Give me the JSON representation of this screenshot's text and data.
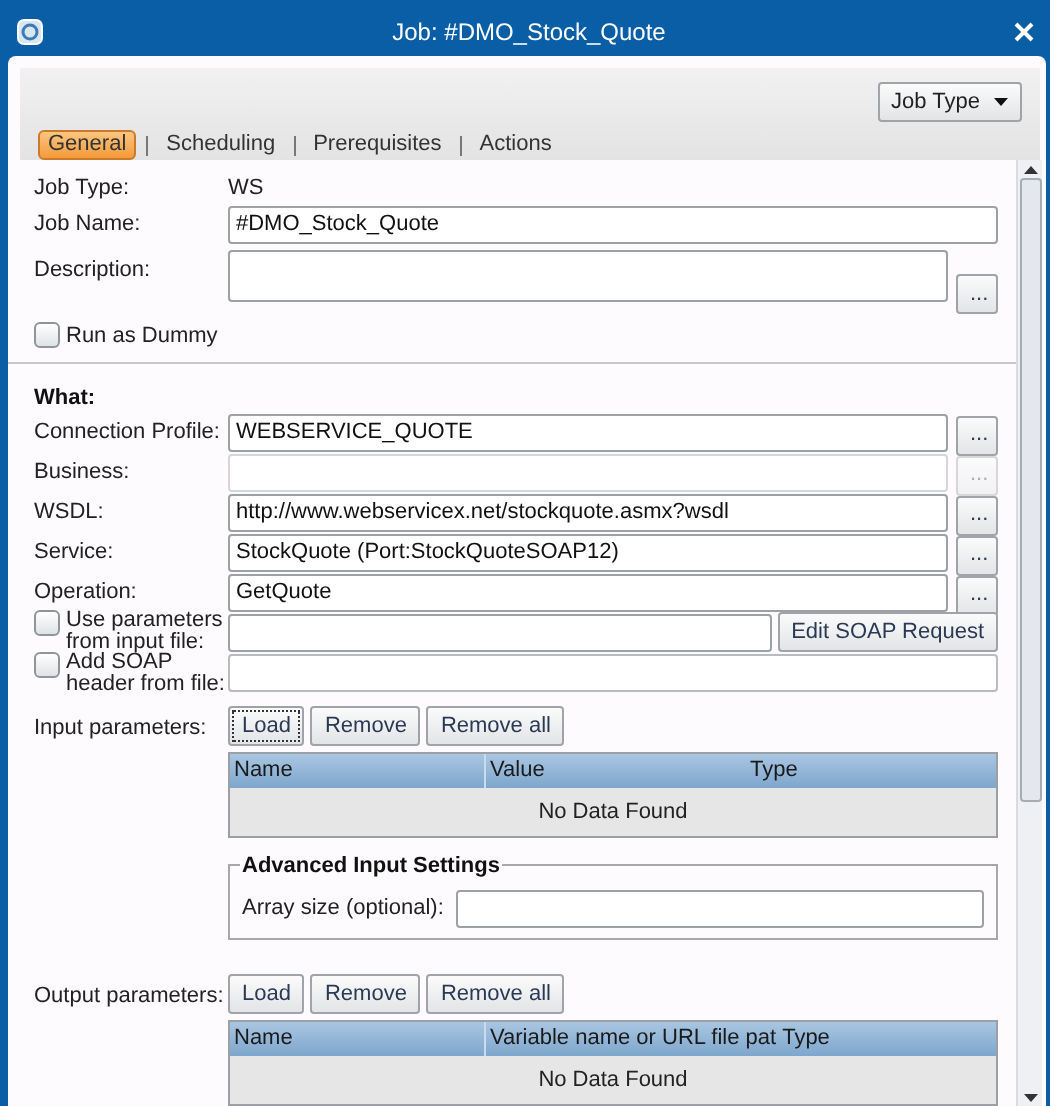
{
  "window": {
    "title": "Job: #DMO_Stock_Quote"
  },
  "job_type_button": {
    "label": "Job Type"
  },
  "tabs": [
    {
      "label": "General",
      "selected": true
    },
    {
      "label": "Scheduling",
      "selected": false
    },
    {
      "label": "Prerequisites",
      "selected": false
    },
    {
      "label": "Actions",
      "selected": false
    }
  ],
  "general": {
    "job_type": {
      "label": "Job Type:",
      "value": "WS"
    },
    "job_name": {
      "label": "Job Name:",
      "value": "#DMO_Stock_Quote"
    },
    "description": {
      "label": "Description:",
      "browse": "..."
    },
    "run_as_dummy": {
      "label": "Run as Dummy",
      "checked": false
    }
  },
  "what": {
    "heading": "What:",
    "fields": [
      {
        "label": "Connection Profile:",
        "value": "WEBSERVICE_QUOTE",
        "disabled": false,
        "browse": "..."
      },
      {
        "label": "Business:",
        "disabled": true,
        "browse": "..."
      },
      {
        "label": "WSDL:",
        "value": "http://www.webservicex.net/stockquote.asmx?wsdl",
        "disabled": false,
        "browse": "..."
      },
      {
        "label": "Service:",
        "value": "StockQuote (Port:StockQuoteSOAP12)",
        "disabled": false,
        "browse": "..."
      },
      {
        "label": "Operation:",
        "value": "GetQuote",
        "disabled": false,
        "browse": "..."
      }
    ],
    "use_params": {
      "label": "Use parameters from input file:",
      "checked": false,
      "button": "Edit SOAP Request"
    },
    "add_soap_header": {
      "label": "Add SOAP header from file:",
      "checked": false
    }
  },
  "input_parameters": {
    "label": "Input parameters:",
    "buttons": [
      {
        "label": "Load",
        "focused": true
      },
      {
        "label": "Remove",
        "focused": false
      },
      {
        "label": "Remove all",
        "focused": false
      }
    ],
    "table": {
      "columns": [
        "Name",
        "Value",
        "Type"
      ],
      "empty_text": "No Data Found"
    }
  },
  "advanced": {
    "title": "Advanced Input Settings",
    "array_size_label": "Array size (optional):"
  },
  "output_parameters": {
    "label": "Output parameters:",
    "buttons": [
      {
        "label": "Load",
        "focused": false
      },
      {
        "label": "Remove",
        "focused": false
      },
      {
        "label": "Remove all",
        "focused": false
      }
    ],
    "table": {
      "columns": [
        "Name",
        "Variable name or URL file pat",
        "Type"
      ],
      "empty_text": "No Data Found"
    }
  }
}
